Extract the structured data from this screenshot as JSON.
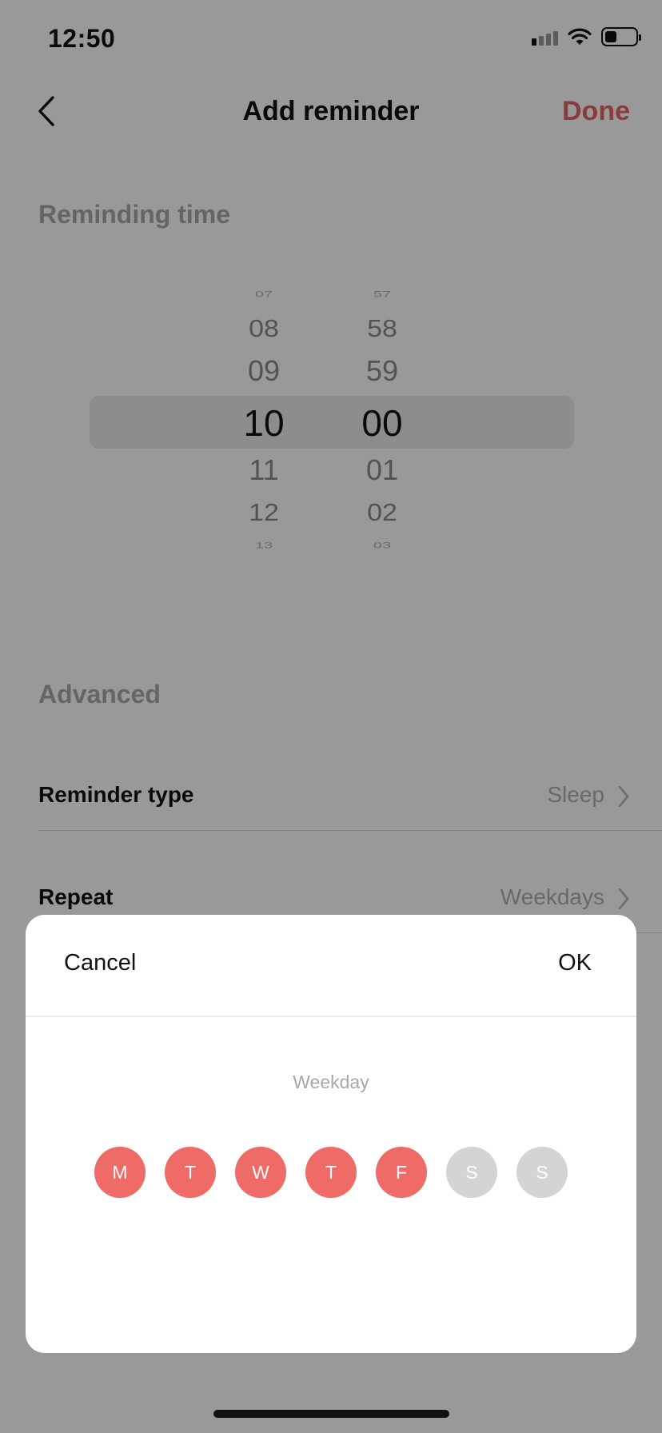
{
  "status_bar": {
    "time": "12:50"
  },
  "nav": {
    "title": "Add reminder",
    "done_label": "Done"
  },
  "colors": {
    "accent": "#e8635f",
    "day_selected": "#ee6b67",
    "day_unselected": "#d4d4d4"
  },
  "reminding_time": {
    "section_label": "Reminding time",
    "hours": [
      "07",
      "08",
      "09",
      "10",
      "11",
      "12",
      "13"
    ],
    "minutes": [
      "57",
      "58",
      "59",
      "00",
      "01",
      "02",
      "03"
    ],
    "selected_hour": "10",
    "selected_minute": "00"
  },
  "advanced": {
    "section_label": "Advanced",
    "rows": [
      {
        "label": "Reminder type",
        "value": "Sleep"
      },
      {
        "label": "Repeat",
        "value": "Weekdays"
      }
    ]
  },
  "sheet": {
    "cancel_label": "Cancel",
    "ok_label": "OK",
    "subtitle": "Weekday",
    "days": [
      {
        "label": "M",
        "selected": true
      },
      {
        "label": "T",
        "selected": true
      },
      {
        "label": "W",
        "selected": true
      },
      {
        "label": "T",
        "selected": true
      },
      {
        "label": "F",
        "selected": true
      },
      {
        "label": "S",
        "selected": false
      },
      {
        "label": "S",
        "selected": false
      }
    ]
  },
  "icons": {
    "back": "chevron-left-icon",
    "row_chevron": "chevron-right-icon",
    "signal": "cellular-signal-icon",
    "wifi": "wifi-icon",
    "battery": "battery-icon"
  }
}
